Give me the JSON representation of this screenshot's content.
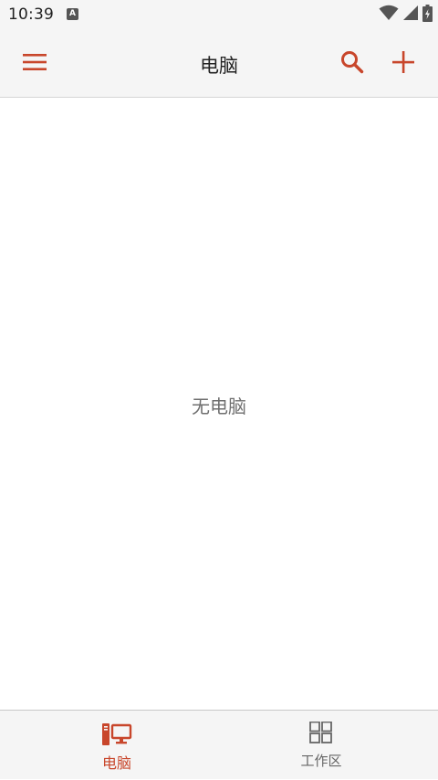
{
  "status_bar": {
    "time": "10:39",
    "notification_glyph": "A",
    "icons": [
      "wifi-icon",
      "cell-signal-icon",
      "battery-charging-icon"
    ]
  },
  "app_bar": {
    "title": "电脑",
    "menu_icon": "hamburger-menu-icon",
    "search_icon": "search-icon",
    "add_icon": "plus-icon",
    "accent_color": "#c8462b"
  },
  "main": {
    "empty_message": "无电脑"
  },
  "bottom_nav": {
    "items": [
      {
        "label": "电脑",
        "icon": "computer-icon",
        "selected": true,
        "color": "#c8462b"
      },
      {
        "label": "工作区",
        "icon": "workspace-grid-icon",
        "selected": false,
        "color": "#666666"
      }
    ]
  }
}
